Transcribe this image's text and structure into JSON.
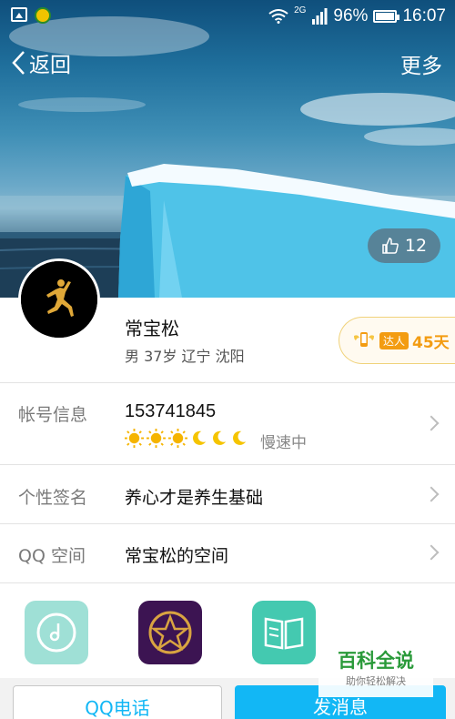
{
  "status_bar": {
    "network": "2G",
    "battery": "96%",
    "time": "16:07"
  },
  "nav": {
    "back_label": "返回",
    "more_label": "更多"
  },
  "like": {
    "count": "12",
    "icon": "thumb-up-icon"
  },
  "profile": {
    "name": "常宝松",
    "meta": "男 37岁 辽宁 沈阳"
  },
  "badge": {
    "tag": "达人",
    "days": "45天"
  },
  "rows": {
    "account": {
      "label": "帐号信息",
      "value": "153741845",
      "level_status": "慢速中"
    },
    "signature": {
      "label": "个性签名",
      "value": "养心才是养生基础"
    },
    "qzone": {
      "label": "QQ 空间",
      "value": "常宝松的空间"
    }
  },
  "watermark": {
    "title": "百科全说",
    "subtitle": "助你轻松解决"
  },
  "buttons": {
    "call": "QQ电话",
    "message": "发消息"
  },
  "colors": {
    "accent": "#12b7f5",
    "badge": "#f39c12"
  }
}
